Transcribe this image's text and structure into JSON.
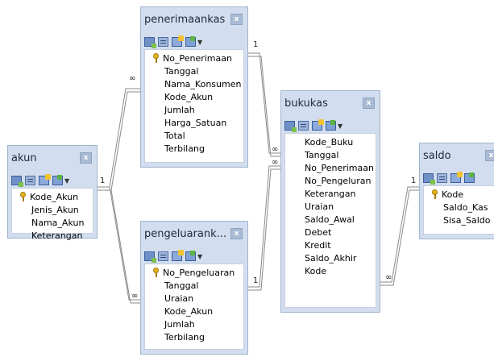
{
  "tables": {
    "penerimaankas": {
      "title": "penerimaankas",
      "close": "x",
      "fields": [
        "No_Penerimaan",
        "Tanggal",
        "Nama_Konsumen",
        "Kode_Akun",
        "Jumlah",
        "Harga_Satuan",
        "Total",
        "Terbilang"
      ]
    },
    "akun": {
      "title": "akun",
      "close": "x",
      "fields": [
        "Kode_Akun",
        "Jenis_Akun",
        "Nama_Akun",
        "Keterangan"
      ]
    },
    "pengeluarankas": {
      "title": "pengeluarank...",
      "close": "x",
      "fields": [
        "No_Pengeluaran",
        "Tanggal",
        "Uraian",
        "Kode_Akun",
        "Jumlah",
        "Terbilang"
      ]
    },
    "bukukas": {
      "title": "bukukas",
      "close": "x",
      "fields": [
        "Kode_Buku",
        "Tanggal",
        "No_Penerimaan",
        "No_Pengeluran",
        "Keterangan",
        "Uraian",
        "Saldo_Awal",
        "Debet",
        "Kredit",
        "Saldo_Akhir",
        "Kode"
      ]
    },
    "saldo": {
      "title": "saldo",
      "close": "x",
      "fields": [
        "Kode",
        "Saldo_Kas",
        "Sisa_Saldo"
      ]
    }
  },
  "relationships": {
    "one": "1",
    "many": "∞"
  },
  "icons": {
    "primary_key": "key-icon",
    "toolbar": [
      "add-field-icon",
      "field-list-icon",
      "table-properties-icon",
      "insert-icon"
    ]
  }
}
